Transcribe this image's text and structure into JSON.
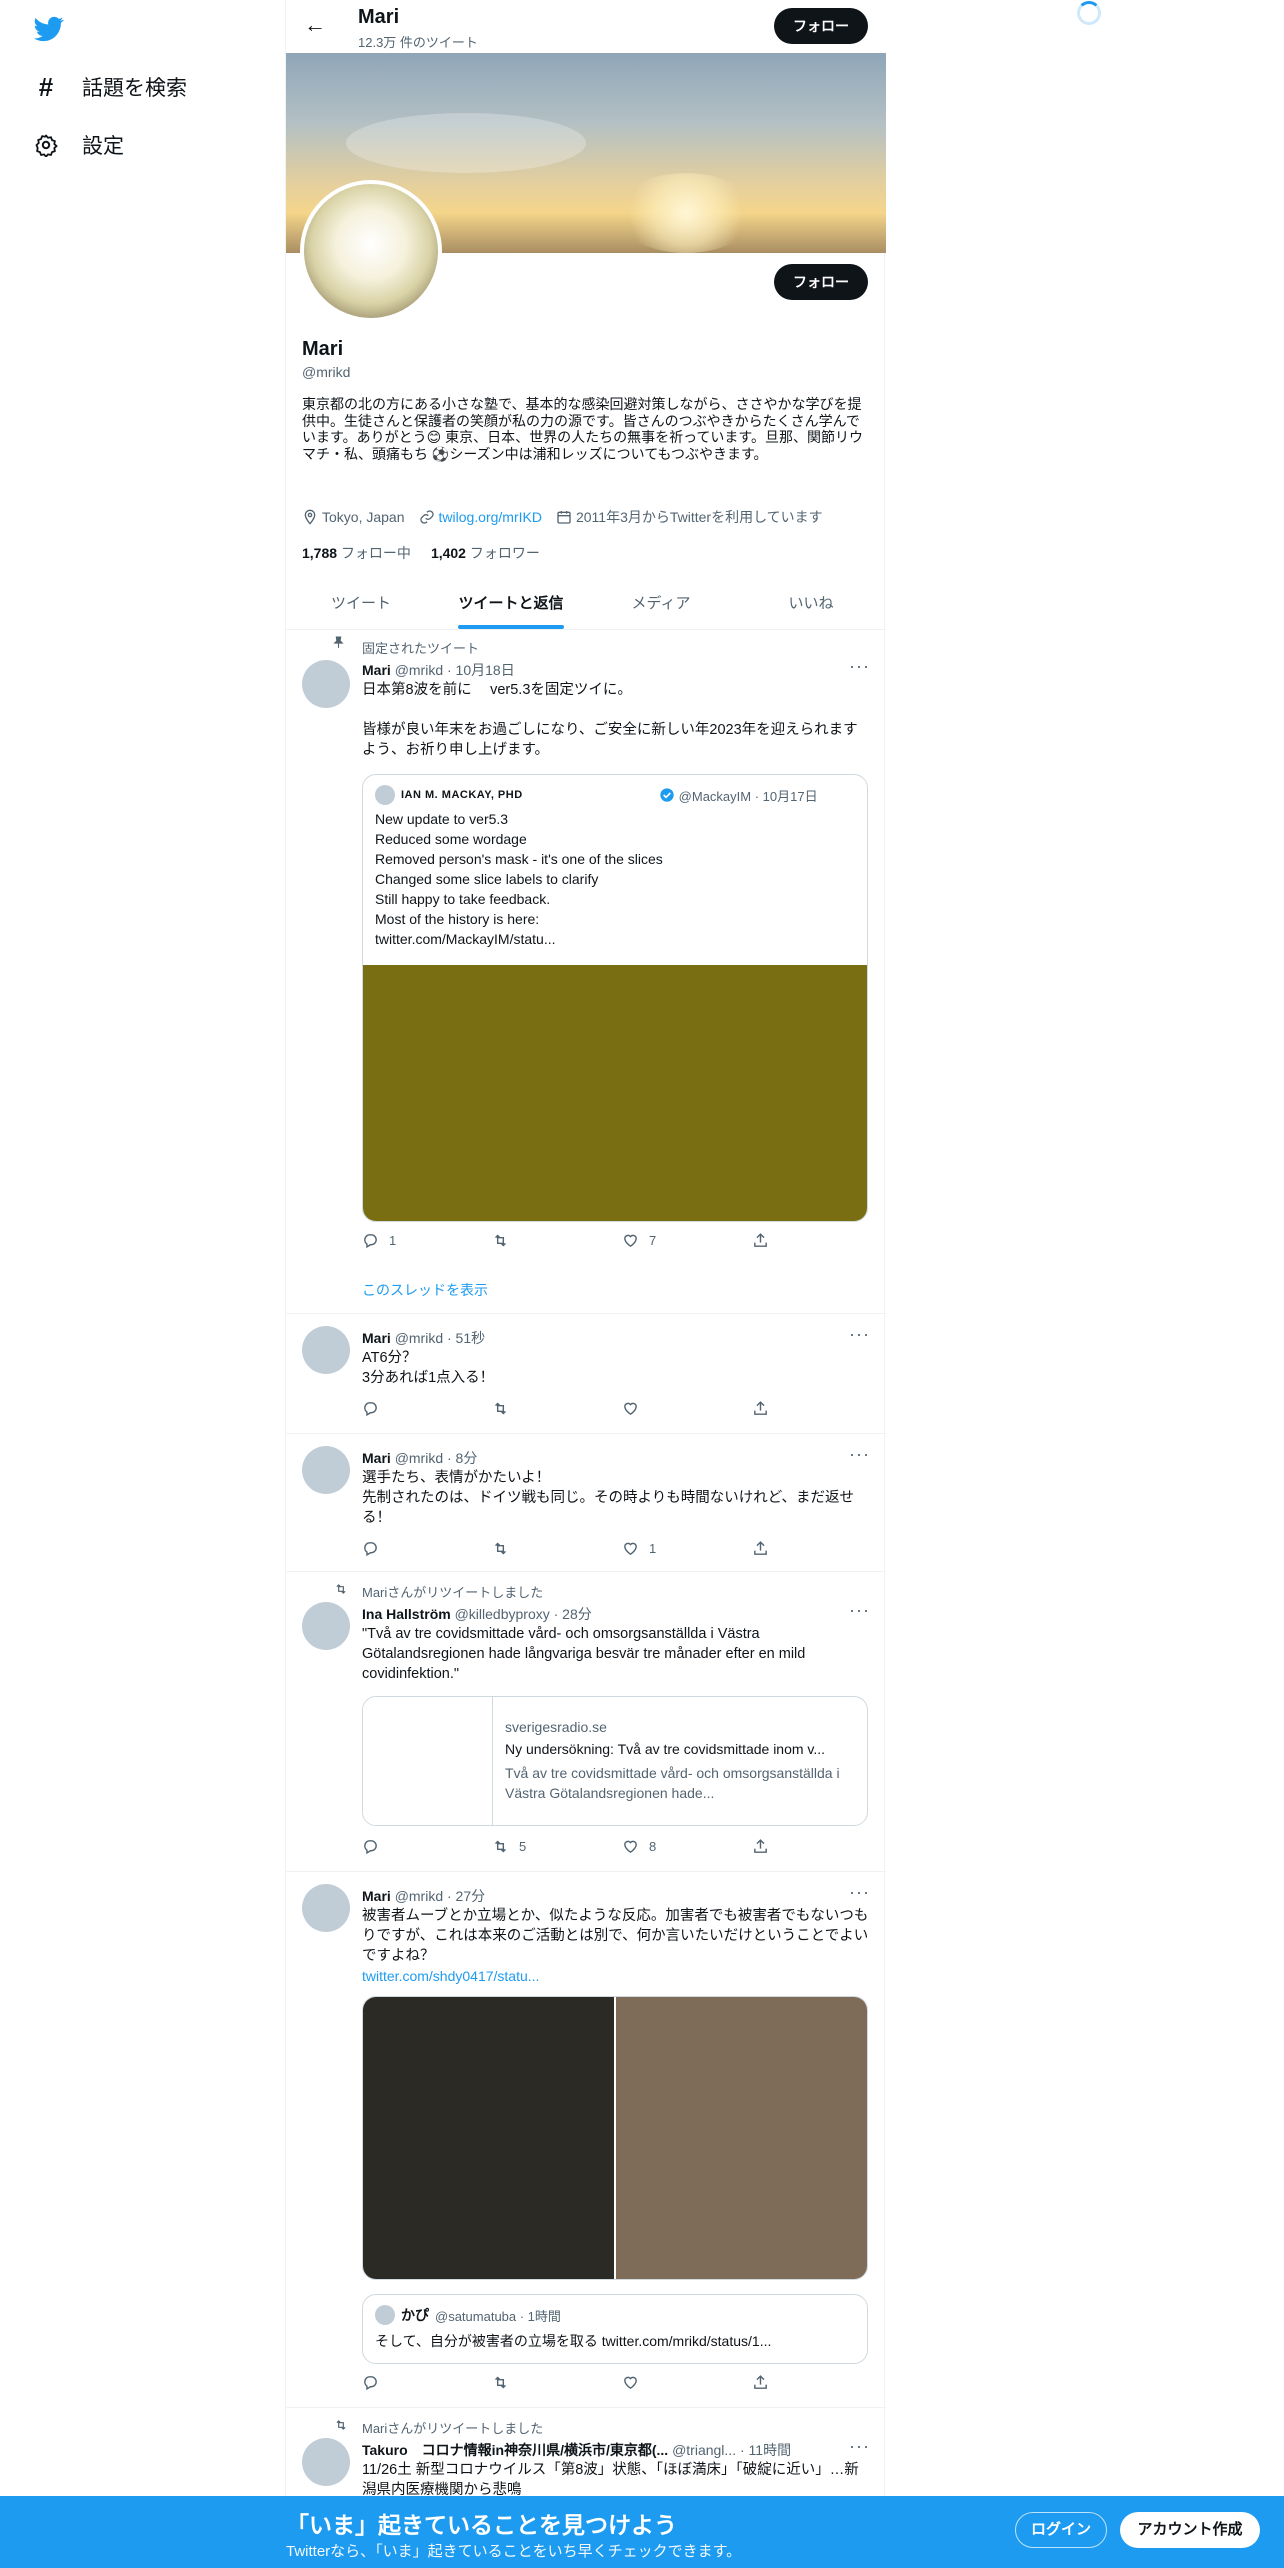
{
  "nav": {
    "explore_label": "話題を検索",
    "settings_label": "設定"
  },
  "header": {
    "name": "Mari",
    "tweet_count": "12.3万 件のツイート",
    "follow_label": "フォロー"
  },
  "profile": {
    "name": "Mari",
    "handle": "@mrikd",
    "follow_label": "フォロー",
    "bio": "東京都の北の方にある小さな塾で、基本的な感染回避対策しながら、ささやかな学びを提供中。生徒さんと保護者の笑顔が私の力の源です。皆さんのつぶやきからたくさん学んでいます。ありがとう😊 東京、日本、世界の人たちの無事を祈っています。旦那、関節リウマチ・私、頭痛もち ⚽シーズン中は浦和レッズについてもつぶやきます。",
    "location": "Tokyo, Japan",
    "link": "twilog.org/mrIKD",
    "joined": "2011年3月からTwitterを利用しています",
    "following_count": "1,788",
    "following_label": "フォロー中",
    "followers_count": "1,402",
    "followers_label": "フォロワー"
  },
  "tabs": [
    {
      "label": "ツイート"
    },
    {
      "label": "ツイートと返信"
    },
    {
      "label": "メディア"
    },
    {
      "label": "いいね"
    }
  ],
  "tweets": [
    {
      "social": "固定されたツイート",
      "name": "Mari",
      "meta": "@mrikd · 10月18日",
      "text": "日本第8波を前に　 ver5.3を固定ツイに。\n\n皆様が良い年末をお過ごしになり、ご安全に新しい年2023年を迎えられますよう、お祈り申し上げます。",
      "quote_name": "IAN M. MACKAY, PHD",
      "quote_meta": "@MackayIM · 10月17日",
      "quote_text": "New update to ver5.3\n     Reduced some wordage\n     Removed person's mask - it's one of the slices\n     Changed some slice labels to clarify\nStill happy to take feedback.\nMost of the history is here:\ntwitter.com/MackayIM/statu...",
      "media_color": "#7a6e12",
      "reply": "1",
      "retweet": "",
      "like": "7",
      "thread_label": "このスレッドを表示"
    },
    {
      "name": "Mari",
      "meta": "@mrikd · 51秒",
      "text": "AT6分？\n3分あれば1点入る！",
      "reply": "",
      "retweet": "",
      "like": ""
    },
    {
      "name": "Mari",
      "meta": "@mrikd · 8分",
      "text": "選手たち、表情がかたいよ！\n先制されたのは、ドイツ戦も同じ。その時よりも時間ないけれど、まだ返せる！",
      "reply": "",
      "retweet": "",
      "like": "1"
    },
    {
      "social": "Mariさんがリツイートしました",
      "name": "Ina Hallström",
      "meta": "@killedbyproxy · 28分",
      "text": "\"Två av tre covidsmittade vård- och omsorgsanställda i Västra Götalandsregionen hade långvariga besvär tre månader efter en mild covidinfektion.\"",
      "card_domain": "sverigesradio.se",
      "card_title": "Ny undersökning: Två av tre covidsmittade inom v...",
      "card_desc": "Två av tre covidsmittade vård- och omsorgsanställda i Västra Götalandsregionen hade...",
      "reply": "",
      "retweet": "5",
      "like": "8"
    },
    {
      "name": "Mari",
      "meta": "@mrikd · 27分",
      "text": "被害者ムーブとか立場とか、似たような反応。加害者でも被害者でもないつもりですが、これは本来のご活動とは別で、何か言いたいだけということでよいですよね？",
      "link": "twitter.com/shdy0417/statu...",
      "media_left_color": "#2c2a25",
      "media_right_color": "#7e6c58",
      "quote_name": "かぴ",
      "quote_meta": "@satumatuba · 1時間",
      "quote_text": "そして、自分が被害者の立場を取る twitter.com/mrikd/status/1...",
      "reply": "",
      "retweet": "",
      "like": ""
    },
    {
      "social": "Mariさんがリツイートしました",
      "name": "Takuro　コロナ情報in神奈川県/横浜市/東京都(...",
      "meta": "@triangl... · 11時間",
      "text": "11/26土 新型コロナウイルス「第8波」状態、「ほぼ満床」「破綻に近い」…新潟県内医療機関から悲鳴"
    }
  ],
  "bottom": {
    "title": "「いま」起きていることを見つけよう",
    "subtitle": "Twitterなら、「いま」起きていることをいち早くチェックできます。",
    "login_label": "ログイン",
    "signup_label": "アカウント作成"
  }
}
